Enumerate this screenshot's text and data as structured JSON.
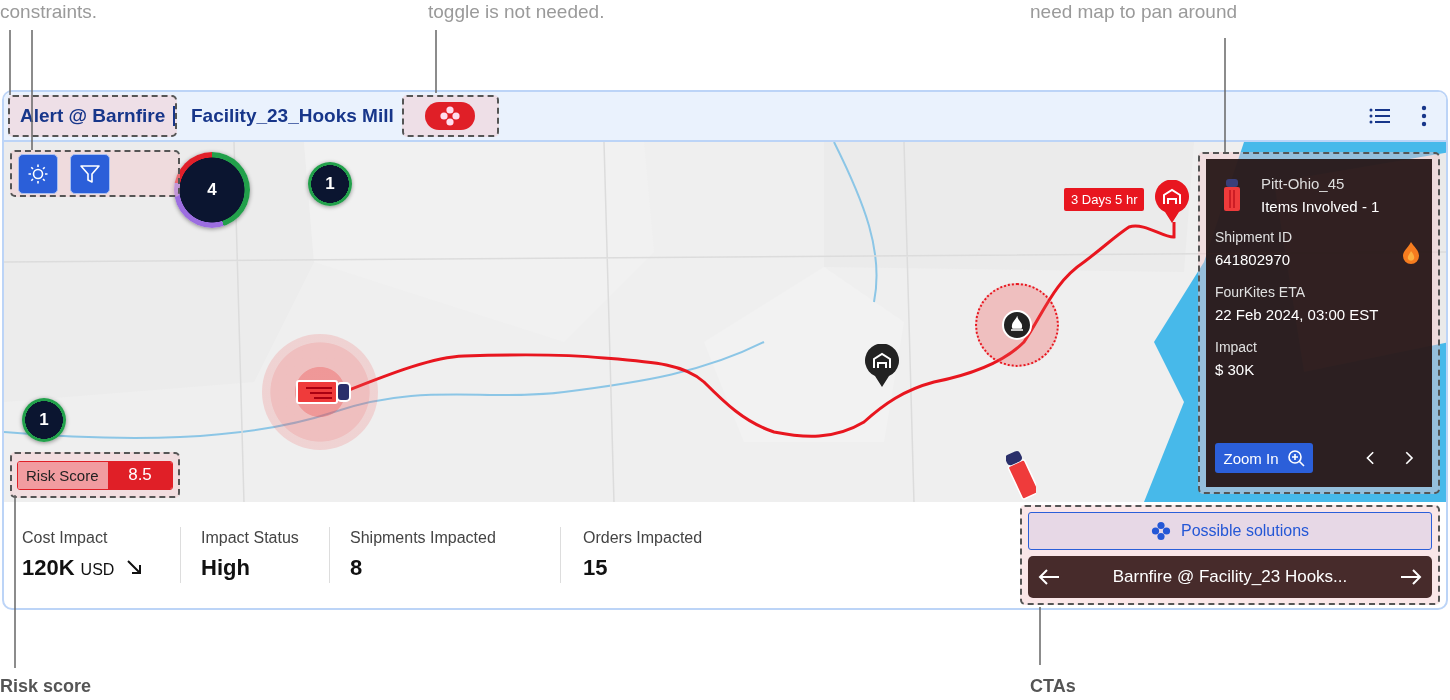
{
  "annotations": {
    "top": [
      "constraints.",
      "toggle is not needed.",
      "need map to pan around"
    ],
    "bottom": [
      "Risk score",
      "CTAs"
    ]
  },
  "header": {
    "alert": "Alert @ Barnfire",
    "facility": "Facility_23_Hooks Mill",
    "solutions_toggle": {
      "on": true
    }
  },
  "map": {
    "clusters": [
      {
        "count": "4"
      },
      {
        "count": "1"
      },
      {
        "count": "1"
      }
    ],
    "eta_badge": "3 Days 5 hr",
    "risk": {
      "label": "Risk Score",
      "value": "8.5"
    }
  },
  "panel": {
    "carrier": "Pitt-Ohio_45",
    "items": "Items Involved - 1",
    "fields": [
      {
        "label": "Shipment ID",
        "value": "641802970"
      },
      {
        "label": "FourKites ETA",
        "value": "22 Feb 2024, 03:00 EST"
      },
      {
        "label": "Impact",
        "value": "$ 30K"
      }
    ],
    "zoom_button": "Zoom In"
  },
  "stats": [
    {
      "label": "Cost Impact",
      "value": "120K",
      "unit": "USD"
    },
    {
      "label": "Impact Status",
      "value": "High"
    },
    {
      "label": "Shipments Impacted",
      "value": "8"
    },
    {
      "label": "Orders Impacted",
      "value": "15"
    }
  ],
  "ctas": {
    "solutions": "Possible solutions",
    "nav": "Barnfire @ Facility_23 Hooks..."
  }
}
